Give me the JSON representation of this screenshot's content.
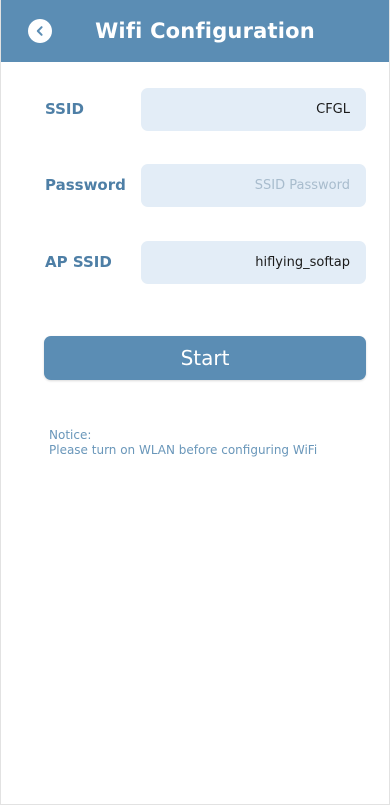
{
  "header": {
    "title": "Wifi Configuration",
    "back_icon": "chevron-left-icon"
  },
  "form": {
    "ssid": {
      "label": "SSID",
      "value": "CFGL",
      "placeholder": ""
    },
    "password": {
      "label": "Password",
      "value": "",
      "placeholder": "SSID Password"
    },
    "ap_ssid": {
      "label": "AP SSID",
      "value": "hiflying_softap",
      "placeholder": ""
    }
  },
  "start_button": {
    "label": "Start"
  },
  "notice": {
    "title": "Notice:",
    "text": "Please turn on WLAN before configuring WiFi"
  },
  "colors": {
    "primary": "#5b8db4",
    "label": "#4e7fa6",
    "input_bg": "#e3edf7",
    "placeholder": "#a8bccd",
    "notice": "#6a97ba"
  }
}
